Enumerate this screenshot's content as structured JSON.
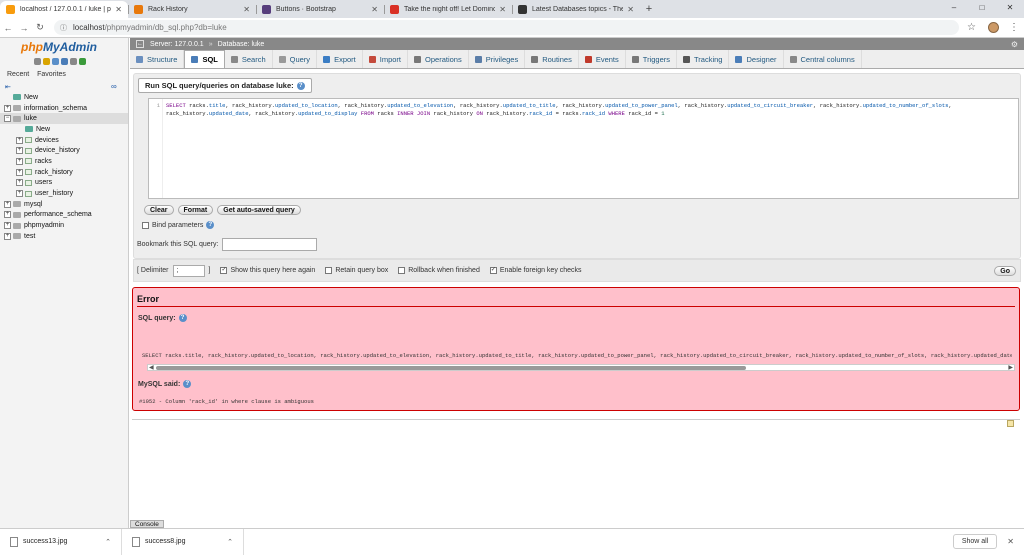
{
  "browser": {
    "tabs": [
      {
        "title": "localhost / 127.0.0.1 / luke | php",
        "icon": "phpmyadmin-favicon",
        "color": "#f89c0e"
      },
      {
        "title": "Rack History",
        "icon": "rack-history-favicon",
        "color": "#e8780a"
      },
      {
        "title": "Buttons · Bootstrap",
        "icon": "bootstrap-favicon",
        "color": "#563d7c"
      },
      {
        "title": "Take the night off! Let Domino's",
        "icon": "gmail-favicon",
        "color": "#d93025"
      },
      {
        "title": "Latest Databases topics - The Sit",
        "icon": "sitepoint-favicon",
        "color": "#333333"
      }
    ],
    "url_host": "localhost",
    "url_path": "/phpmyadmin/db_sql.php?db=luke"
  },
  "sidebar": {
    "logo_php": "php",
    "logo_myadmin": "MyAdmin",
    "recent": "Recent",
    "favorites": "Favorites",
    "tree": [
      {
        "label": "New",
        "level": 0,
        "type": "new"
      },
      {
        "label": "information_schema",
        "level": 0,
        "type": "db"
      },
      {
        "label": "luke",
        "level": 0,
        "type": "db",
        "selected": true
      },
      {
        "label": "New",
        "level": 1,
        "type": "new"
      },
      {
        "label": "devices",
        "level": 1,
        "type": "table"
      },
      {
        "label": "device_history",
        "level": 1,
        "type": "table"
      },
      {
        "label": "racks",
        "level": 1,
        "type": "table"
      },
      {
        "label": "rack_history",
        "level": 1,
        "type": "table"
      },
      {
        "label": "users",
        "level": 1,
        "type": "table"
      },
      {
        "label": "user_history",
        "level": 1,
        "type": "table"
      },
      {
        "label": "mysql",
        "level": 0,
        "type": "db"
      },
      {
        "label": "performance_schema",
        "level": 0,
        "type": "db"
      },
      {
        "label": "phpmyadmin",
        "level": 0,
        "type": "db"
      },
      {
        "label": "test",
        "level": 0,
        "type": "db"
      }
    ]
  },
  "breadcrumb": {
    "server": "Server: 127.0.0.1",
    "database": "Database: luke"
  },
  "menu_tabs": [
    {
      "label": "Structure",
      "icon": "structure-icon",
      "color": "#6a8fbf"
    },
    {
      "label": "SQL",
      "icon": "sql-icon",
      "color": "#4a7db8",
      "active": true
    },
    {
      "label": "Search",
      "icon": "search-icon",
      "color": "#888888"
    },
    {
      "label": "Query",
      "icon": "query-icon",
      "color": "#999999"
    },
    {
      "label": "Export",
      "icon": "export-icon",
      "color": "#3b7dc4"
    },
    {
      "label": "Import",
      "icon": "import-icon",
      "color": "#c44a3b"
    },
    {
      "label": "Operations",
      "icon": "wrench-icon",
      "color": "#777777"
    },
    {
      "label": "Privileges",
      "icon": "privileges-icon",
      "color": "#5a7da8"
    },
    {
      "label": "Routines",
      "icon": "routines-icon",
      "color": "#777777"
    },
    {
      "label": "Events",
      "icon": "events-icon",
      "color": "#c0392b"
    },
    {
      "label": "Triggers",
      "icon": "triggers-icon",
      "color": "#777777"
    },
    {
      "label": "Tracking",
      "icon": "tracking-icon",
      "color": "#555555"
    },
    {
      "label": "Designer",
      "icon": "designer-icon",
      "color": "#4a7db8"
    },
    {
      "label": "Central columns",
      "icon": "central-columns-icon",
      "color": "#888888"
    }
  ],
  "sql_form": {
    "legend": "Run SQL query/queries on database luke:",
    "line_number": "1",
    "query_tokens": [
      {
        "t": "SELECT ",
        "c": "kw"
      },
      {
        "t": "racks.",
        "c": ""
      },
      {
        "t": "title",
        "c": "fld"
      },
      {
        "t": ", ",
        "c": ""
      },
      {
        "t": "rack_history.",
        "c": ""
      },
      {
        "t": "updated_to_location",
        "c": "fld"
      },
      {
        "t": ", ",
        "c": ""
      },
      {
        "t": "rack_history.",
        "c": ""
      },
      {
        "t": "updated_to_elevation",
        "c": "fld"
      },
      {
        "t": ", ",
        "c": ""
      },
      {
        "t": "rack_history.",
        "c": ""
      },
      {
        "t": "updated_to_title",
        "c": "fld"
      },
      {
        "t": ", ",
        "c": ""
      },
      {
        "t": "rack_history.",
        "c": ""
      },
      {
        "t": "updated_to_power_panel",
        "c": "fld"
      },
      {
        "t": ", ",
        "c": ""
      },
      {
        "t": "rack_history.",
        "c": ""
      },
      {
        "t": "updated_to_circuit_breaker",
        "c": "fld"
      },
      {
        "t": ", ",
        "c": ""
      },
      {
        "t": "rack_history.",
        "c": ""
      },
      {
        "t": "updated_to_number_of_slots",
        "c": "fld"
      },
      {
        "t": ", ",
        "c": ""
      },
      {
        "t": "rack_history.",
        "c": ""
      },
      {
        "t": "updated_date",
        "c": "fld"
      },
      {
        "t": ", ",
        "c": ""
      },
      {
        "t": "rack_history.",
        "c": ""
      },
      {
        "t": "updated_to_display",
        "c": "fld"
      },
      {
        "t": " FROM ",
        "c": "kw"
      },
      {
        "t": "racks ",
        "c": ""
      },
      {
        "t": "INNER JOIN ",
        "c": "kw"
      },
      {
        "t": "rack_history ",
        "c": ""
      },
      {
        "t": "ON ",
        "c": "kw"
      },
      {
        "t": "rack_history.",
        "c": ""
      },
      {
        "t": "rack_id",
        "c": "fld"
      },
      {
        "t": " = ",
        "c": ""
      },
      {
        "t": "racks.",
        "c": ""
      },
      {
        "t": "rack_id",
        "c": "fld"
      },
      {
        "t": " WHERE ",
        "c": "kw"
      },
      {
        "t": "rack_id = ",
        "c": ""
      },
      {
        "t": "1",
        "c": "num"
      }
    ],
    "clear": "Clear",
    "format": "Format",
    "get_auto_saved": "Get auto-saved query",
    "bind_parameters": "Bind parameters",
    "bookmark_label": "Bookmark this SQL query:"
  },
  "options": {
    "delimiter_label": "[ Delimiter",
    "delimiter_value": ";",
    "delimiter_close": "]",
    "show_query": "Show this query here again",
    "show_query_checked": true,
    "retain_query_box": "Retain query box",
    "retain_checked": false,
    "rollback": "Rollback when finished",
    "rollback_checked": false,
    "foreign_key": "Enable foreign key checks",
    "foreign_key_checked": true,
    "go": "Go"
  },
  "error": {
    "title": "Error",
    "sql_query_label": "SQL query:",
    "sql_text": "SELECT racks.title, rack_history.updated_to_location, rack_history.updated_to_elevation, rack_history.updated_to_title, rack_history.updated_to_power_panel, rack_history.updated_to_circuit_breaker, rack_history.updated_to_number_of_slots, rack_history.updated_date, rack_history.",
    "mysql_said": "MySQL said:",
    "message": "#1052 - Column 'rack_id' in where clause is ambiguous"
  },
  "console_label": "Console",
  "downloads": {
    "items": [
      "success13.jpg",
      "success8.jpg"
    ],
    "show_all": "Show all"
  }
}
